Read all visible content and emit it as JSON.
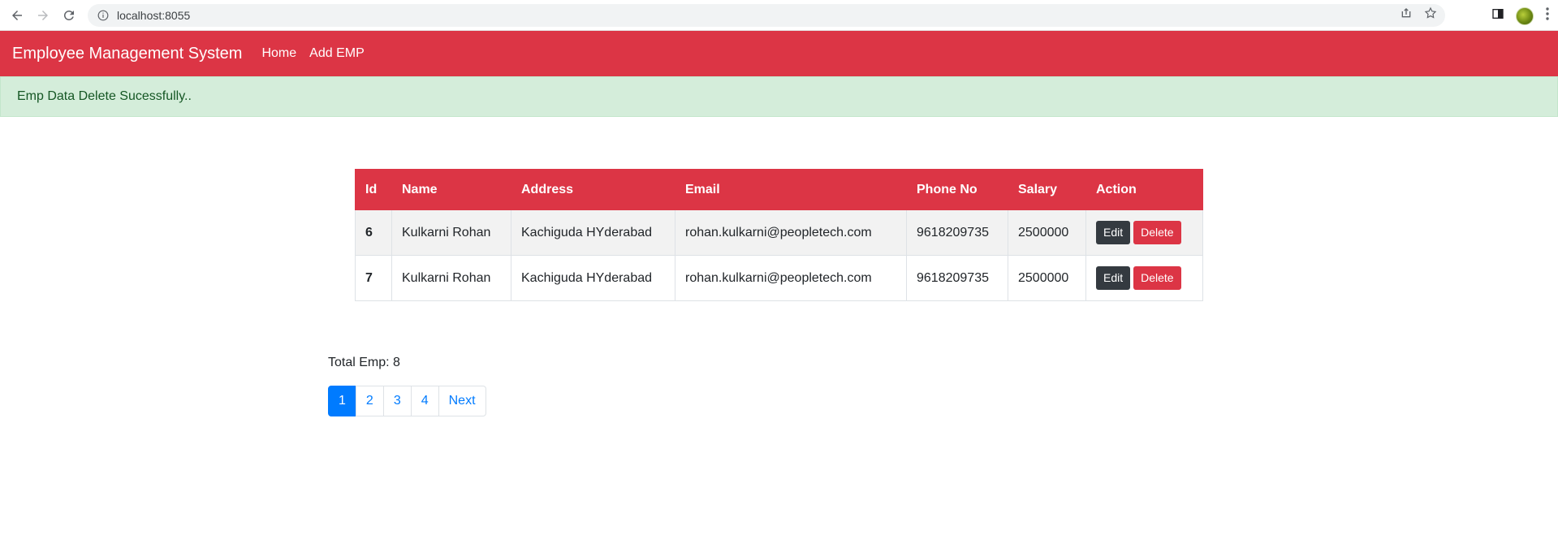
{
  "browser": {
    "url": "localhost:8055",
    "icons": [
      "back-arrow-icon",
      "forward-arrow-icon",
      "reload-icon",
      "info-icon",
      "share-icon",
      "star-icon",
      "side-panel-icon",
      "profile-avatar",
      "more-menu-icon"
    ]
  },
  "navbar": {
    "brand": "Employee Management System",
    "links": [
      "Home",
      "Add EMP"
    ],
    "color": "#dc3545"
  },
  "alert": {
    "message": "Emp Data Delete Sucessfully..",
    "color": "#d4edda"
  },
  "table": {
    "headers": [
      "Id",
      "Name",
      "Address",
      "Email",
      "Phone No",
      "Salary",
      "Action"
    ],
    "rows": [
      {
        "id": "6",
        "name": "Kulkarni Rohan",
        "address": "Kachiguda HYderabad",
        "email": "rohan.kulkarni@peopletech.com",
        "phone": "9618209735",
        "salary": "2500000"
      },
      {
        "id": "7",
        "name": "Kulkarni Rohan",
        "address": "Kachiguda HYderabad",
        "email": "rohan.kulkarni@peopletech.com",
        "phone": "9618209735",
        "salary": "2500000"
      }
    ],
    "edit_label": "Edit",
    "delete_label": "Delete"
  },
  "footer": {
    "total": "Total Emp: 8",
    "pages": [
      "1",
      "2",
      "3",
      "4"
    ],
    "active_page": "1",
    "next_label": "Next"
  }
}
